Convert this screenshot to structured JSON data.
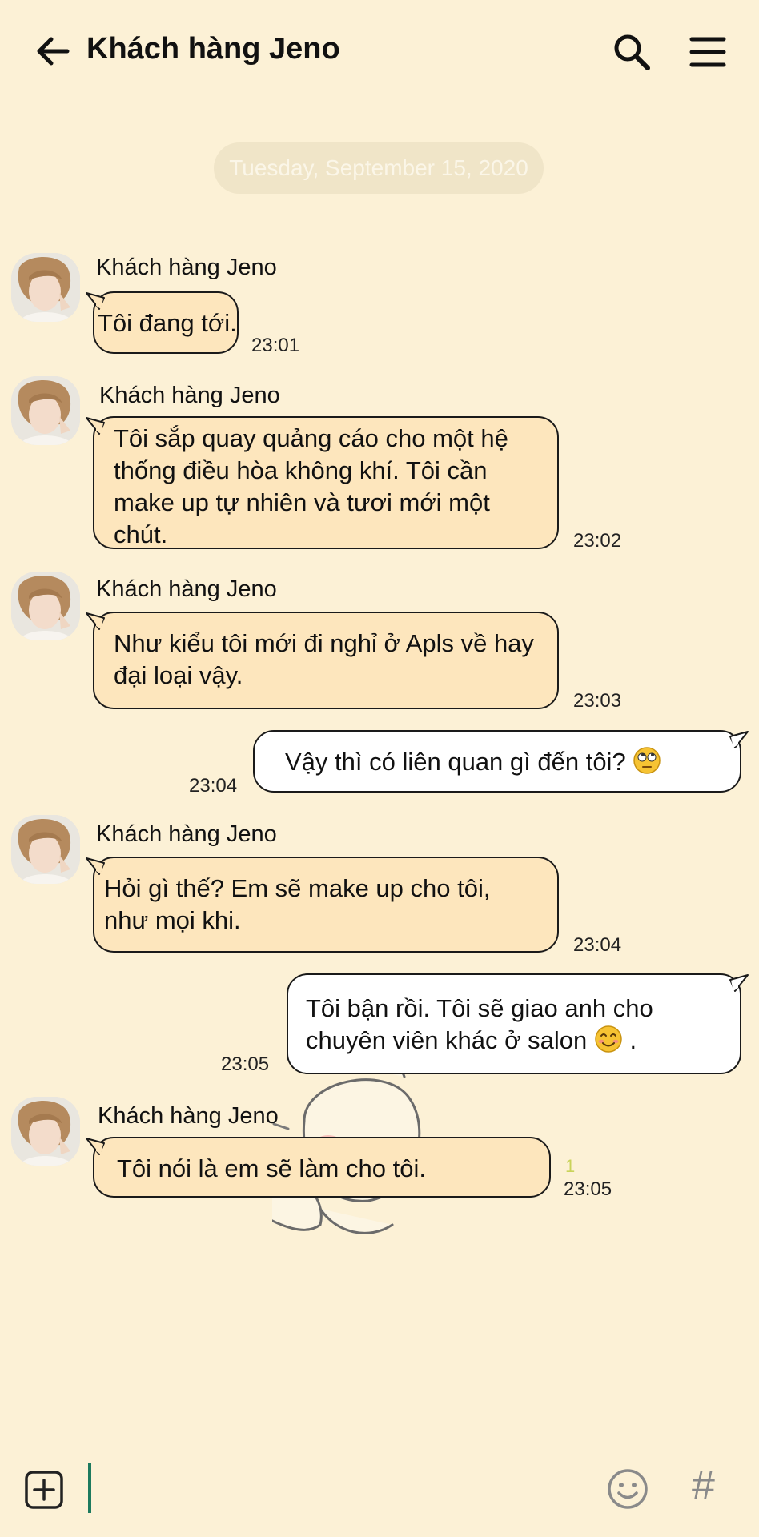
{
  "header": {
    "title": "Khách hàng Jeno",
    "back_icon": "arrow-left-icon",
    "search_icon": "search-icon",
    "menu_icon": "hamburger-menu-icon"
  },
  "date_separator": "Tuesday, September 15, 2020",
  "messages": [
    {
      "direction": "in",
      "sender": "Khách hàng Jeno",
      "text": "Tôi đang tới.",
      "time": "23:01"
    },
    {
      "direction": "in",
      "sender": "Khách hàng Jeno",
      "text": "Tôi sắp quay quảng cáo cho một hệ thống điều hòa không khí. Tôi cần make up tự nhiên và tươi mới một chút.",
      "time": "23:02"
    },
    {
      "direction": "in",
      "sender": "Khách hàng Jeno",
      "text": "Như kiểu tôi mới đi nghỉ ở Apls về hay đại loại vậy.",
      "time": "23:03"
    },
    {
      "direction": "out",
      "text": "Vậy thì có liên quan gì đến tôi?",
      "emoji": "rolling-eyes-emoji",
      "time": "23:04"
    },
    {
      "direction": "in",
      "sender": "Khách hàng Jeno",
      "text": "Hỏi gì thế? Em sẽ make up cho tôi, như mọi khi.",
      "time": "23:04"
    },
    {
      "direction": "out",
      "text": "Tôi bận rồi. Tôi sẽ giao anh cho chuyên viên khác ở salon",
      "emoji": "smiling-emoji",
      "text_after": ".",
      "time": "23:05"
    },
    {
      "direction": "in",
      "sender": "Khách hàng Jeno",
      "text": "Tôi nói là em sẽ làm cho tôi.",
      "time": "23:05",
      "unread": "1"
    }
  ],
  "input_bar": {
    "plus_icon": "plus-square-icon",
    "emoji_icon": "emoji-icon",
    "hashtag_label": "#"
  },
  "colors": {
    "background": "#fcf1d6",
    "incoming_bubble": "#fde6bd",
    "outgoing_bubble": "#ffffff",
    "cursor": "#1d7a5e",
    "unread": "#c9d35a"
  }
}
